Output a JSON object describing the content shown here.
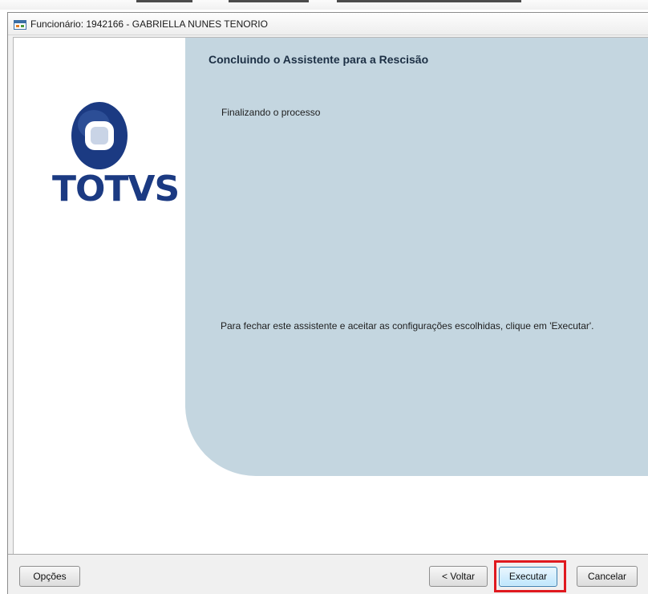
{
  "window": {
    "title": "Funcionário: 1942166 - GABRIELLA NUNES TENORIO"
  },
  "logo": {
    "text": "TOTVS",
    "colors": {
      "globe_outer": "#1b3a82",
      "globe_inner": "#ffffff",
      "text": "#1b3a82"
    }
  },
  "panel": {
    "heading": "Concluindo o Assistente para a Rescisão",
    "subtitle": "Finalizando o processo",
    "instruction": "Para fechar este assistente e aceitar as configurações escolhidas, clique em 'Executar'.",
    "background": "#c4d6e0"
  },
  "buttons": {
    "opcoes": "Opções",
    "voltar": "< Voltar",
    "executar": "Executar",
    "cancelar": "Cancelar"
  },
  "highlight": {
    "target": "Executar",
    "color": "#e0191f"
  },
  "icons": {
    "title_icon": "form-window-icon"
  }
}
